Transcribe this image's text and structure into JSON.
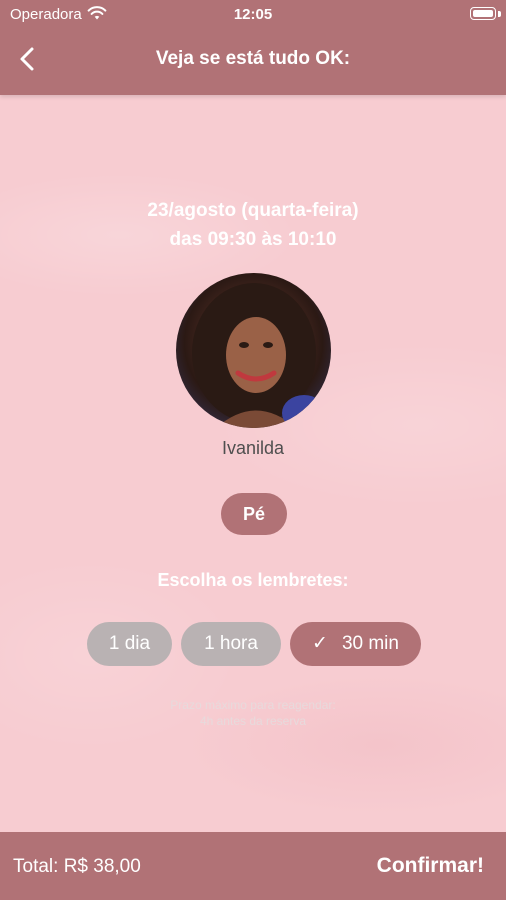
{
  "status_bar": {
    "carrier": "Operadora",
    "time": "12:05"
  },
  "header": {
    "title": "Veja se está tudo OK:"
  },
  "booking": {
    "date_line": "23/agosto (quarta-feira)",
    "time_line": "das 09:30 às 10:10",
    "professional_name": "Ivanilda",
    "service": "Pé"
  },
  "reminders": {
    "title": "Escolha os lembretes:",
    "options": [
      {
        "label": "1 dia",
        "selected": false
      },
      {
        "label": "1 hora",
        "selected": false
      },
      {
        "label": "30 min",
        "selected": true
      }
    ],
    "check_glyph": "✓"
  },
  "note": {
    "line1": "Prazo máximo para reagendar:",
    "line2": "4h antes da reserva"
  },
  "footer": {
    "total": "Total: R$ 38,00",
    "confirm_label": "Confirmar!"
  },
  "colors": {
    "accent": "#b17276",
    "background": "#f8cdd2",
    "pill_off": "#b9b2b3"
  }
}
